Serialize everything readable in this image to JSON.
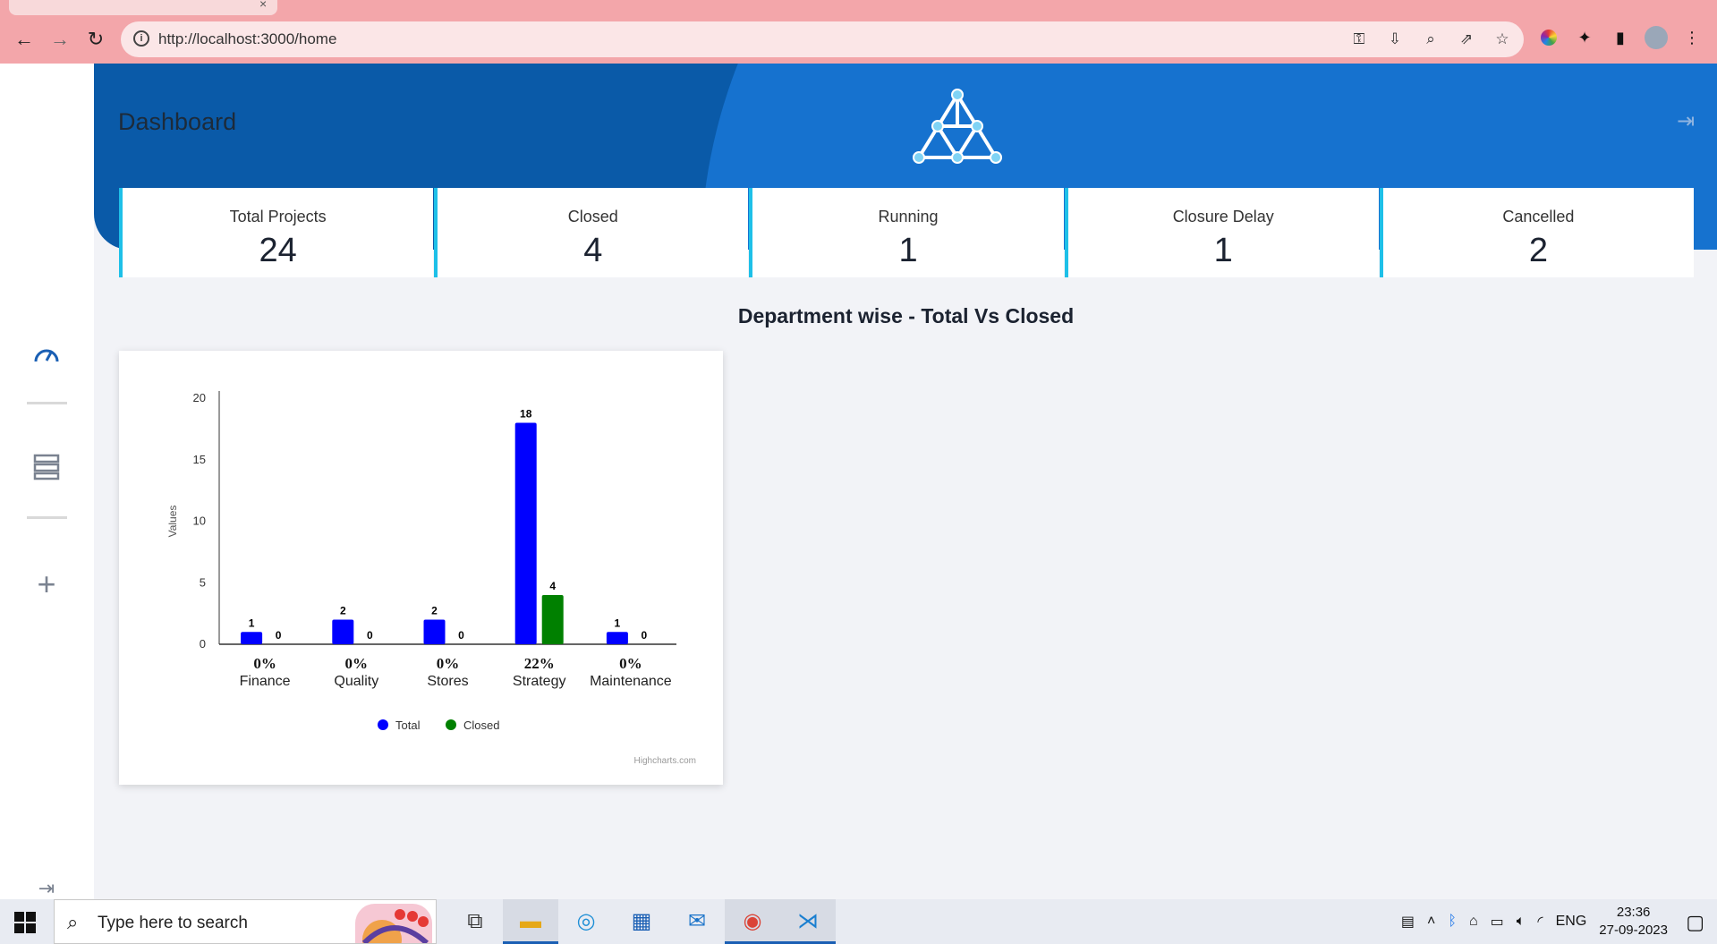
{
  "browser": {
    "url": "http://localhost:3000/home",
    "tab_close_glyph": "×"
  },
  "app": {
    "page_title": "Dashboard",
    "accent_color": "#1ec0e8"
  },
  "stats": [
    {
      "label": "Total Projects",
      "value": "24"
    },
    {
      "label": "Closed",
      "value": "4"
    },
    {
      "label": "Running",
      "value": "1"
    },
    {
      "label": "Closure Delay",
      "value": "1"
    },
    {
      "label": "Cancelled",
      "value": "2"
    }
  ],
  "chart_heading": "Department wise - Total Vs Closed",
  "chart_data": {
    "type": "bar",
    "categories": [
      "Finance",
      "Quality",
      "Stores",
      "Strategy",
      "Maintenance"
    ],
    "category_percentages": [
      "0%",
      "0%",
      "0%",
      "22%",
      "0%"
    ],
    "series": [
      {
        "name": "Total",
        "color": "#0000ff",
        "values": [
          1,
          2,
          2,
          18,
          1
        ]
      },
      {
        "name": "Closed",
        "color": "#008000",
        "values": [
          0,
          0,
          0,
          4,
          0
        ]
      }
    ],
    "ylabel": "Values",
    "ylim": [
      0,
      20
    ],
    "yticks": [
      0,
      5,
      10,
      15,
      20
    ],
    "credit": "Highcharts.com",
    "legend": "bottom-center",
    "grid": false
  },
  "taskbar": {
    "search_placeholder": "Type here to search",
    "language": "ENG",
    "time": "23:36",
    "date": "27-09-2023"
  }
}
